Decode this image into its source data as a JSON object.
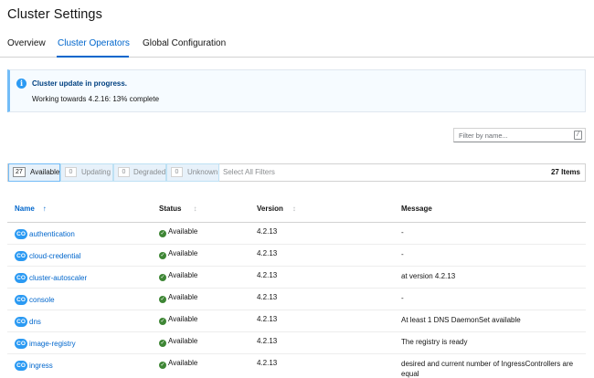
{
  "page": {
    "title": "Cluster Settings"
  },
  "tabs": [
    {
      "label": "Overview"
    },
    {
      "label": "Cluster Operators"
    },
    {
      "label": "Global Configuration"
    }
  ],
  "alert": {
    "icon": "info-icon",
    "title": "Cluster update in progress.",
    "body": "Working towards 4.2.16: 13% complete",
    "progress_percent": 13
  },
  "filter": {
    "placeholder": "Filter by name...",
    "shortcut": "/"
  },
  "status_filters": [
    {
      "count": "27",
      "label": "Available"
    },
    {
      "count": "0",
      "label": "Updating"
    },
    {
      "count": "0",
      "label": "Degraded"
    },
    {
      "count": "0",
      "label": "Unknown"
    }
  ],
  "select_all_label": "Select All Filters",
  "items_count": "27 Items",
  "table": {
    "columns": [
      {
        "label": "Name"
      },
      {
        "label": "Status"
      },
      {
        "label": "Version"
      },
      {
        "label": "Message"
      }
    ],
    "badge_label": "CO",
    "rows": [
      {
        "name": "authentication",
        "status": "Available",
        "version": "4.2.13",
        "message": "-"
      },
      {
        "name": "cloud-credential",
        "status": "Available",
        "version": "4.2.13",
        "message": "-"
      },
      {
        "name": "cluster-autoscaler",
        "status": "Available",
        "version": "4.2.13",
        "message": "at version 4.2.13"
      },
      {
        "name": "console",
        "status": "Available",
        "version": "4.2.13",
        "message": "-"
      },
      {
        "name": "dns",
        "status": "Available",
        "version": "4.2.13",
        "message": "At least 1 DNS DaemonSet available"
      },
      {
        "name": "image-registry",
        "status": "Available",
        "version": "4.2.13",
        "message": "The registry is ready"
      },
      {
        "name": "ingress",
        "status": "Available",
        "version": "4.2.13",
        "message": "desired and current number of IngressControllers are equal"
      }
    ]
  },
  "colors": {
    "accent": "#0066cc",
    "success": "#3e8635",
    "info": "#2b9af3"
  }
}
